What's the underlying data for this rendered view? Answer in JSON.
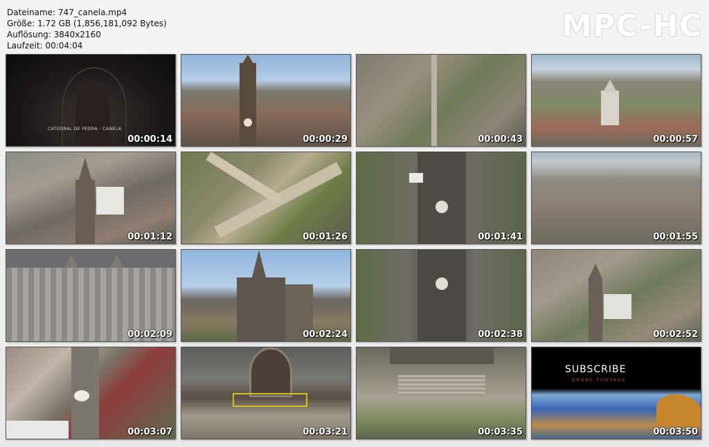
{
  "meta": {
    "filename": "Dateiname: 747_canela.mp4",
    "size": "Größe: 1.72 GB (1,856,181,092 Bytes)",
    "resolution": "Auflösung: 3840x2160",
    "duration": "Laufzeit: 00:04:04"
  },
  "brand": "MPC-HC",
  "thumbnails": [
    {
      "time": "00:00:14",
      "caption": "CATEDRAL DE PEDRA · CANELA"
    },
    {
      "time": "00:00:29"
    },
    {
      "time": "00:00:43"
    },
    {
      "time": "00:00:57"
    },
    {
      "time": "00:01:12"
    },
    {
      "time": "00:01:26"
    },
    {
      "time": "00:01:41"
    },
    {
      "time": "00:01:55"
    },
    {
      "time": "00:02:09"
    },
    {
      "time": "00:02:24"
    },
    {
      "time": "00:02:38"
    },
    {
      "time": "00:02:52"
    },
    {
      "time": "00:03:07"
    },
    {
      "time": "00:03:21"
    },
    {
      "time": "00:03:35"
    },
    {
      "time": "00:03:50",
      "subscribe": "SUBSCRIBE",
      "subscribe_small": "DRONE FOOTAGE"
    }
  ]
}
